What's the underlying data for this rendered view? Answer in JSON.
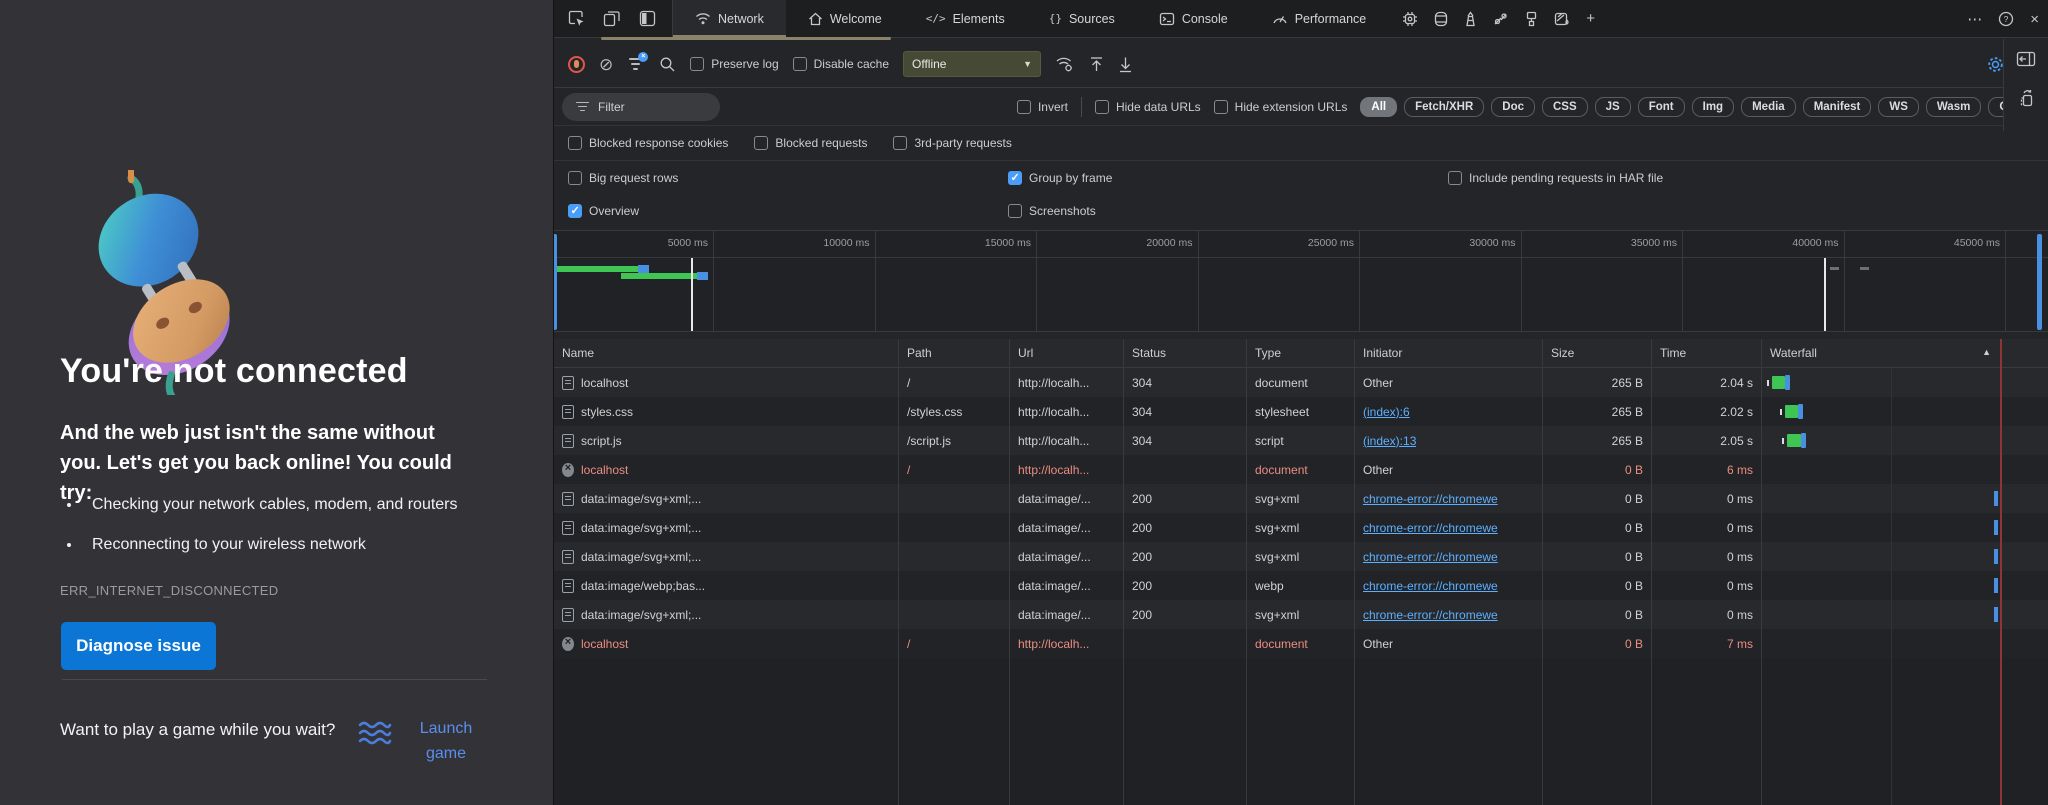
{
  "error_page": {
    "title": "You're not connected",
    "subtitle": "And the web just isn't the same without you. Let's get you back online! You could try:",
    "bullets": [
      "Checking your network cables, modem, and routers",
      "Reconnecting to your wireless network"
    ],
    "error_code": "ERR_INTERNET_DISCONNECTED",
    "diagnose_button_label": "Diagnose issue",
    "game_prompt": "Want to play a game while you wait?",
    "launch_game_label": "Launch game",
    "accent_blue": "#0b76d6",
    "link_blue": "#5b8def"
  },
  "devtools": {
    "tabs": [
      {
        "label": "Network",
        "icon": "wifi-icon",
        "selected": true
      },
      {
        "label": "Welcome",
        "icon": "home-icon",
        "selected": false
      },
      {
        "label": "Elements",
        "icon": "code-icon",
        "selected": false
      },
      {
        "label": "Sources",
        "icon": "braces-icon",
        "selected": false
      },
      {
        "label": "Console",
        "icon": "console-icon",
        "selected": false
      },
      {
        "label": "Performance",
        "icon": "gauge-icon",
        "selected": false
      }
    ],
    "network_toolbar": {
      "preserve_log_label": "Preserve log",
      "disable_cache_label": "Disable cache",
      "throttling_value": "Offline"
    },
    "filter_bar": {
      "filter_placeholder": "Filter",
      "invert_label": "Invert",
      "hide_data_urls_label": "Hide data URLs",
      "hide_extension_urls_label": "Hide extension URLs",
      "type_pills": [
        {
          "label": "All",
          "selected": true
        },
        {
          "label": "Fetch/XHR",
          "selected": false
        },
        {
          "label": "Doc",
          "selected": false
        },
        {
          "label": "CSS",
          "selected": false
        },
        {
          "label": "JS",
          "selected": false
        },
        {
          "label": "Font",
          "selected": false
        },
        {
          "label": "Img",
          "selected": false
        },
        {
          "label": "Media",
          "selected": false
        },
        {
          "label": "Manifest",
          "selected": false
        },
        {
          "label": "WS",
          "selected": false
        },
        {
          "label": "Wasm",
          "selected": false
        },
        {
          "label": "Other",
          "selected": false
        }
      ]
    },
    "blocked_row": {
      "blocked_response_cookies_label": "Blocked response cookies",
      "blocked_requests_label": "Blocked requests",
      "third_party_requests_label": "3rd-party requests"
    },
    "options": {
      "big_request_rows": {
        "label": "Big request rows",
        "checked": false
      },
      "group_by_frame": {
        "label": "Group by frame",
        "checked": true
      },
      "include_pending": {
        "label": "Include pending requests in HAR file",
        "checked": false
      },
      "overview": {
        "label": "Overview",
        "checked": true
      },
      "screenshots": {
        "label": "Screenshots",
        "checked": false
      }
    },
    "timeline": {
      "ticks": [
        "5000 ms",
        "10000 ms",
        "15000 ms",
        "20000 ms",
        "25000 ms",
        "30000 ms",
        "35000 ms",
        "40000 ms",
        "45000 ms"
      ]
    },
    "table": {
      "columns": [
        "Name",
        "Path",
        "Url",
        "Status",
        "Type",
        "Initiator",
        "Size",
        "Time",
        "Waterfall"
      ],
      "sort_indicator": "▲",
      "rows": [
        {
          "name": "localhost",
          "icon": "document",
          "path": "/",
          "url": "http://localh...",
          "status": "304",
          "type": "document",
          "initiator": "Other",
          "initiator_link": false,
          "size": "265 B",
          "time": "2.04 s",
          "error": false,
          "waterfall": {
            "kind": "bar",
            "offset": 5,
            "green": 13
          }
        },
        {
          "name": "styles.css",
          "icon": "stylesheet",
          "path": "/styles.css",
          "url": "http://localh...",
          "status": "304",
          "type": "stylesheet",
          "initiator": "(index):6",
          "initiator_link": true,
          "size": "265 B",
          "time": "2.02 s",
          "error": false,
          "waterfall": {
            "kind": "bar",
            "offset": 18,
            "green": 13
          }
        },
        {
          "name": "script.js",
          "icon": "script",
          "path": "/script.js",
          "url": "http://localh...",
          "status": "304",
          "type": "script",
          "initiator": "(index):13",
          "initiator_link": true,
          "size": "265 B",
          "time": "2.05 s",
          "error": false,
          "waterfall": {
            "kind": "bar",
            "offset": 20,
            "green": 14
          }
        },
        {
          "name": "localhost",
          "icon": "error",
          "path": "/",
          "url": "http://localh...",
          "status": "",
          "type": "document",
          "initiator": "Other",
          "initiator_link": false,
          "size": "0 B",
          "time": "6 ms",
          "error": true,
          "waterfall": {
            "kind": "none"
          }
        },
        {
          "name": "data:image/svg+xml;...",
          "icon": "image",
          "path": "",
          "url": "data:image/...",
          "status": "200",
          "type": "svg+xml",
          "initiator": "chrome-error://chromewe",
          "initiator_link": true,
          "size": "0 B",
          "time": "0 ms",
          "error": false,
          "waterfall": {
            "kind": "tick"
          }
        },
        {
          "name": "data:image/svg+xml;...",
          "icon": "image",
          "path": "",
          "url": "data:image/...",
          "status": "200",
          "type": "svg+xml",
          "initiator": "chrome-error://chromewe",
          "initiator_link": true,
          "size": "0 B",
          "time": "0 ms",
          "error": false,
          "waterfall": {
            "kind": "tick"
          }
        },
        {
          "name": "data:image/svg+xml;...",
          "icon": "image",
          "path": "",
          "url": "data:image/...",
          "status": "200",
          "type": "svg+xml",
          "initiator": "chrome-error://chromewe",
          "initiator_link": true,
          "size": "0 B",
          "time": "0 ms",
          "error": false,
          "waterfall": {
            "kind": "tick"
          }
        },
        {
          "name": "data:image/webp;bas...",
          "icon": "image",
          "path": "",
          "url": "data:image/...",
          "status": "200",
          "type": "webp",
          "initiator": "chrome-error://chromewe",
          "initiator_link": true,
          "size": "0 B",
          "time": "0 ms",
          "error": false,
          "waterfall": {
            "kind": "tick"
          }
        },
        {
          "name": "data:image/svg+xml;...",
          "icon": "image",
          "path": "",
          "url": "data:image/...",
          "status": "200",
          "type": "svg+xml",
          "initiator": "chrome-error://chromewe",
          "initiator_link": true,
          "size": "0 B",
          "time": "0 ms",
          "error": false,
          "waterfall": {
            "kind": "tick"
          }
        },
        {
          "name": "localhost",
          "icon": "error",
          "path": "/",
          "url": "http://localh...",
          "status": "",
          "type": "document",
          "initiator": "Other",
          "initiator_link": false,
          "size": "0 B",
          "time": "7 ms",
          "error": true,
          "waterfall": {
            "kind": "none"
          }
        }
      ]
    }
  }
}
